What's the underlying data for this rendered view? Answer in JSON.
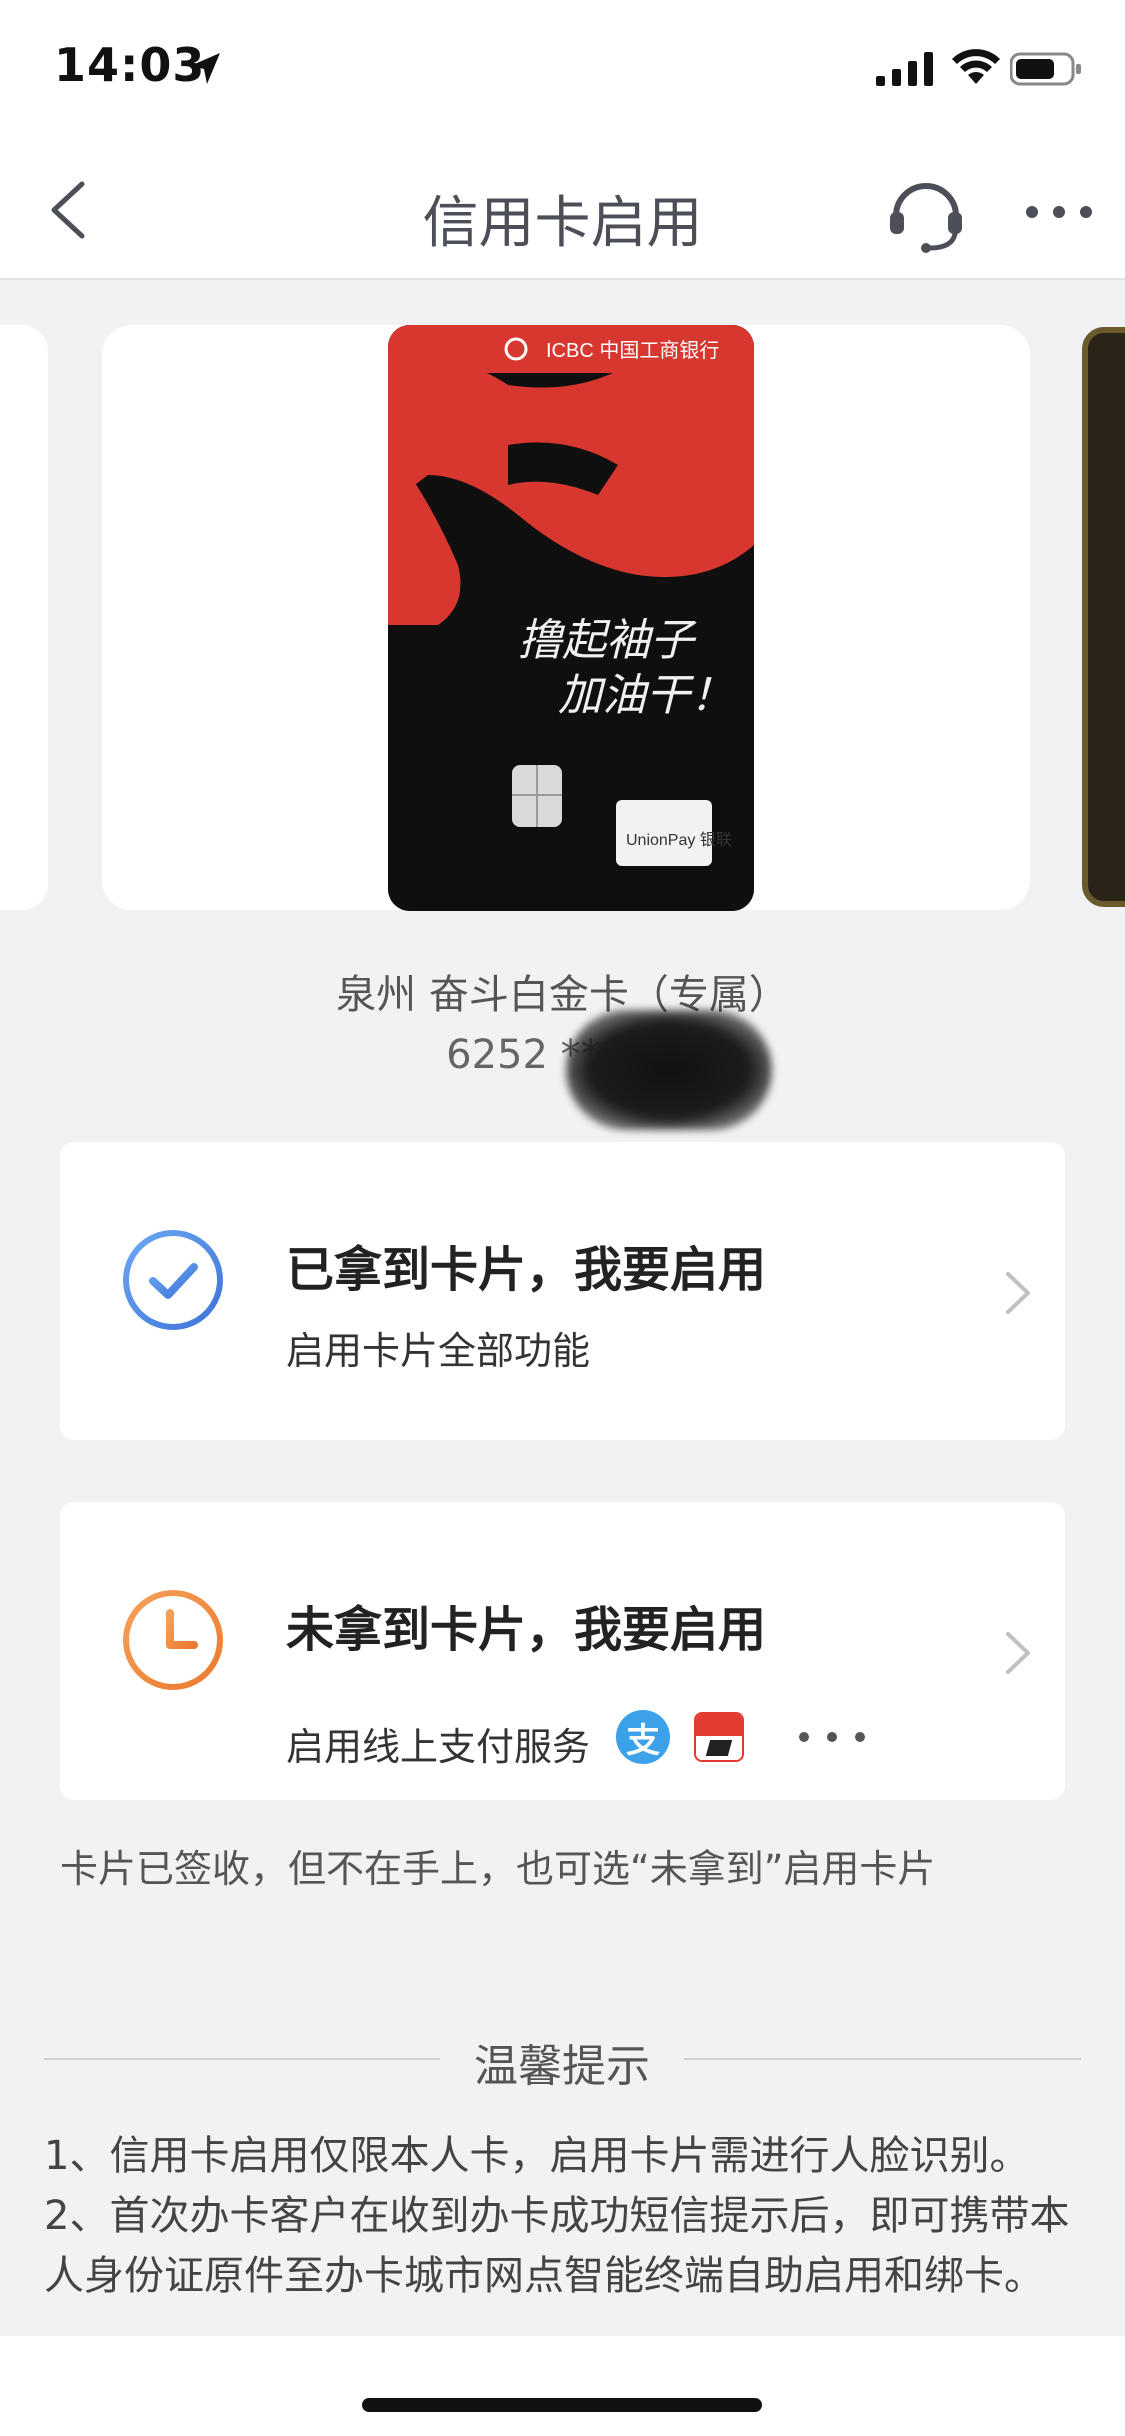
{
  "status_bar": {
    "time": "14:03"
  },
  "nav": {
    "title": "信用卡启用"
  },
  "card": {
    "name": "泉州  奋斗白金卡（专属）",
    "number": "6252 **** 3",
    "image_brand": "ICBC 中国工商银行",
    "image_slogan_1": "撸起袖子",
    "image_slogan_2": "加油干！",
    "image_network": "UnionPay 银联"
  },
  "options": [
    {
      "title": "已拿到卡片，我要启用",
      "subtitle": "启用卡片全部功能",
      "icon": "check-circle-icon",
      "icon_color": "#4a86e8"
    },
    {
      "title": "未拿到卡片，我要启用",
      "subtitle": "启用线上支付服务",
      "icon": "clock-icon",
      "icon_color": "#f08a3c",
      "pay_icons": [
        "alipay-icon",
        "unionpay-icon",
        "more-icon"
      ],
      "alipay_glyph": "支"
    }
  ],
  "hint": "卡片已签收，但不在手上，也可选“未拿到”启用卡片",
  "tips": {
    "title": "温馨提示",
    "items": [
      "1、信用卡启用仅限本人卡，启用卡片需进行人脸识别。",
      "2、首次办卡客户在收到办卡成功短信提示后，即可携带本人身份证原件至办卡城市网点智能终端自助启用和绑卡。"
    ]
  }
}
